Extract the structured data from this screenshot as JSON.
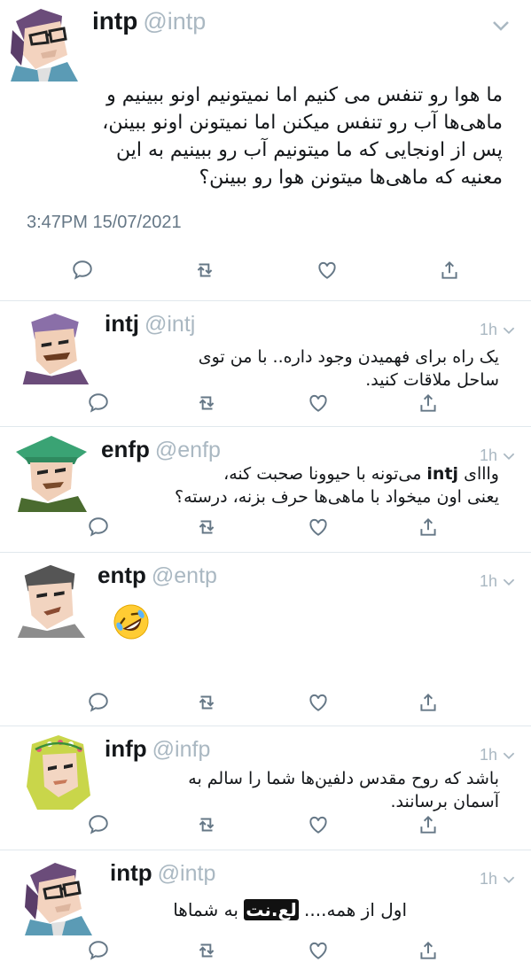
{
  "main_tweet": {
    "name": "intp",
    "handle": "@intp",
    "text": "ما هوا رو تنفس می کنیم اما نمیتونیم اونو ببینیم و\nماهی‌ها آب رو تنفس میکنن اما نمیتونن اونو ببینن،\nپس از اونجایی که ما میتونیم آب رو ببینیم به این\nمعنیه که ماهی‌ها میتونن هوا رو ببینن؟",
    "timestamp": "3:47PM 15/07/2021",
    "icons": [
      "reply-icon",
      "retweet-icon",
      "like-icon",
      "share-icon"
    ]
  },
  "replies": [
    {
      "name": "intj",
      "handle": "@intj",
      "time": "1h",
      "text": "یک راه برای فهمیدن وجود داره.. با من توی\nساحل ملاقات کنید."
    },
    {
      "name": "enfp",
      "handle": "@enfp",
      "time": "1h",
      "text_before": "وااای ",
      "text_latin": "intj",
      "text_after": " می‌تونه با حیوونا صحبت کنه،\nیعنی اون میخواد با ماهی‌ها حرف بزنه، درسته؟"
    },
    {
      "name": "entp",
      "handle": "@entp",
      "time": "1h",
      "emoji": "rolling-on-floor-laughing-emoji"
    },
    {
      "name": "infp",
      "handle": "@infp",
      "time": "1h",
      "text": "باشد که روح مقدس دلفین‌ها شما را سالم به\nآسمان برسانند."
    },
    {
      "name": "intp",
      "handle": "@intp",
      "time": "1h",
      "text_before": "اول از همه.... ",
      "text_censored": "لع.نت",
      "text_after": " به شماها"
    }
  ],
  "colors": {
    "text": "#14171a",
    "muted": "#aab8c2",
    "divider": "#e1e8ed",
    "icon": "#657786"
  }
}
